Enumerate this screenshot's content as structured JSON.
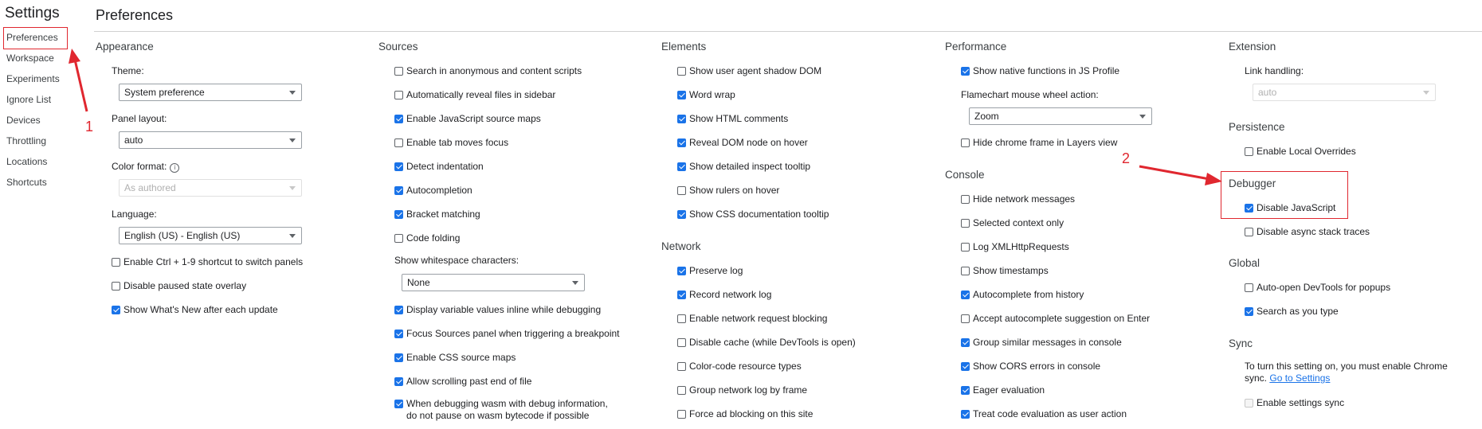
{
  "settings_title": "Settings",
  "sidebar": {
    "items": [
      {
        "label": "Preferences",
        "selected": true
      },
      {
        "label": "Workspace"
      },
      {
        "label": "Experiments"
      },
      {
        "label": "Ignore List"
      },
      {
        "label": "Devices"
      },
      {
        "label": "Throttling"
      },
      {
        "label": "Locations"
      },
      {
        "label": "Shortcuts"
      }
    ]
  },
  "page_title": "Preferences",
  "appearance": {
    "title": "Appearance",
    "theme_label": "Theme:",
    "theme_value": "System preference",
    "panel_layout_label": "Panel layout:",
    "panel_layout_value": "auto",
    "color_format_label": "Color format:",
    "color_format_value": "As authored",
    "language_label": "Language:",
    "language_value": "English (US) - English (US)",
    "checkboxes": [
      {
        "label": "Enable Ctrl + 1-9 shortcut to switch panels",
        "checked": false
      },
      {
        "label": "Disable paused state overlay",
        "checked": false
      },
      {
        "label": "Show What's New after each update",
        "checked": true
      }
    ]
  },
  "sources": {
    "title": "Sources",
    "checkboxes": [
      {
        "label": "Search in anonymous and content scripts",
        "checked": false
      },
      {
        "label": "Automatically reveal files in sidebar",
        "checked": false
      },
      {
        "label": "Enable JavaScript source maps",
        "checked": true
      },
      {
        "label": "Enable tab moves focus",
        "checked": false
      },
      {
        "label": "Detect indentation",
        "checked": true
      },
      {
        "label": "Autocompletion",
        "checked": true
      },
      {
        "label": "Bracket matching",
        "checked": true
      },
      {
        "label": "Code folding",
        "checked": false
      }
    ],
    "whitespace_label": "Show whitespace characters:",
    "whitespace_value": "None",
    "checkboxes2": [
      {
        "label": "Display variable values inline while debugging",
        "checked": true
      },
      {
        "label": "Focus Sources panel when triggering a breakpoint",
        "checked": true
      },
      {
        "label": "Enable CSS source maps",
        "checked": true
      },
      {
        "label": "Allow scrolling past end of file",
        "checked": true
      },
      {
        "label": "When debugging wasm with debug information, do not pause on wasm bytecode if possible",
        "checked": true
      }
    ]
  },
  "elements": {
    "title": "Elements",
    "checkboxes": [
      {
        "label": "Show user agent shadow DOM",
        "checked": false
      },
      {
        "label": "Word wrap",
        "checked": true
      },
      {
        "label": "Show HTML comments",
        "checked": true
      },
      {
        "label": "Reveal DOM node on hover",
        "checked": true
      },
      {
        "label": "Show detailed inspect tooltip",
        "checked": true
      },
      {
        "label": "Show rulers on hover",
        "checked": false
      },
      {
        "label": "Show CSS documentation tooltip",
        "checked": true
      }
    ]
  },
  "network": {
    "title": "Network",
    "checkboxes": [
      {
        "label": "Preserve log",
        "checked": true
      },
      {
        "label": "Record network log",
        "checked": true
      },
      {
        "label": "Enable network request blocking",
        "checked": false
      },
      {
        "label": "Disable cache (while DevTools is open)",
        "checked": false
      },
      {
        "label": "Color-code resource types",
        "checked": false
      },
      {
        "label": "Group network log by frame",
        "checked": false
      },
      {
        "label": "Force ad blocking on this site",
        "checked": false
      }
    ]
  },
  "performance": {
    "title": "Performance",
    "show_native": {
      "label": "Show native functions in JS Profile",
      "checked": true
    },
    "flamechart_label": "Flamechart mouse wheel action:",
    "flamechart_value": "Zoom",
    "hide_chrome": {
      "label": "Hide chrome frame in Layers view",
      "checked": false
    }
  },
  "console": {
    "title": "Console",
    "checkboxes": [
      {
        "label": "Hide network messages",
        "checked": false
      },
      {
        "label": "Selected context only",
        "checked": false
      },
      {
        "label": "Log XMLHttpRequests",
        "checked": false
      },
      {
        "label": "Show timestamps",
        "checked": false
      },
      {
        "label": "Autocomplete from history",
        "checked": true
      },
      {
        "label": "Accept autocomplete suggestion on Enter",
        "checked": false
      },
      {
        "label": "Group similar messages in console",
        "checked": true
      },
      {
        "label": "Show CORS errors in console",
        "checked": true
      },
      {
        "label": "Eager evaluation",
        "checked": true
      },
      {
        "label": "Treat code evaluation as user action",
        "checked": true
      }
    ]
  },
  "extension": {
    "title": "Extension",
    "link_handling_label": "Link handling:",
    "link_handling_value": "auto"
  },
  "persistence": {
    "title": "Persistence",
    "enable_local_overrides": {
      "label": "Enable Local Overrides",
      "checked": false
    }
  },
  "debugger": {
    "title": "Debugger",
    "disable_js": {
      "label": "Disable JavaScript",
      "checked": true
    },
    "disable_async": {
      "label": "Disable async stack traces",
      "checked": false
    }
  },
  "global": {
    "title": "Global",
    "checkboxes": [
      {
        "label": "Auto-open DevTools for popups",
        "checked": false
      },
      {
        "label": "Search as you type",
        "checked": true
      }
    ]
  },
  "sync": {
    "title": "Sync",
    "note": "To turn this setting on, you must enable Chrome sync.",
    "link": "Go to Settings",
    "enable_sync": {
      "label": "Enable settings sync",
      "checked": false
    }
  },
  "annotations": {
    "num1": "1",
    "num2": "2",
    "accent_color": "#e0272f"
  }
}
